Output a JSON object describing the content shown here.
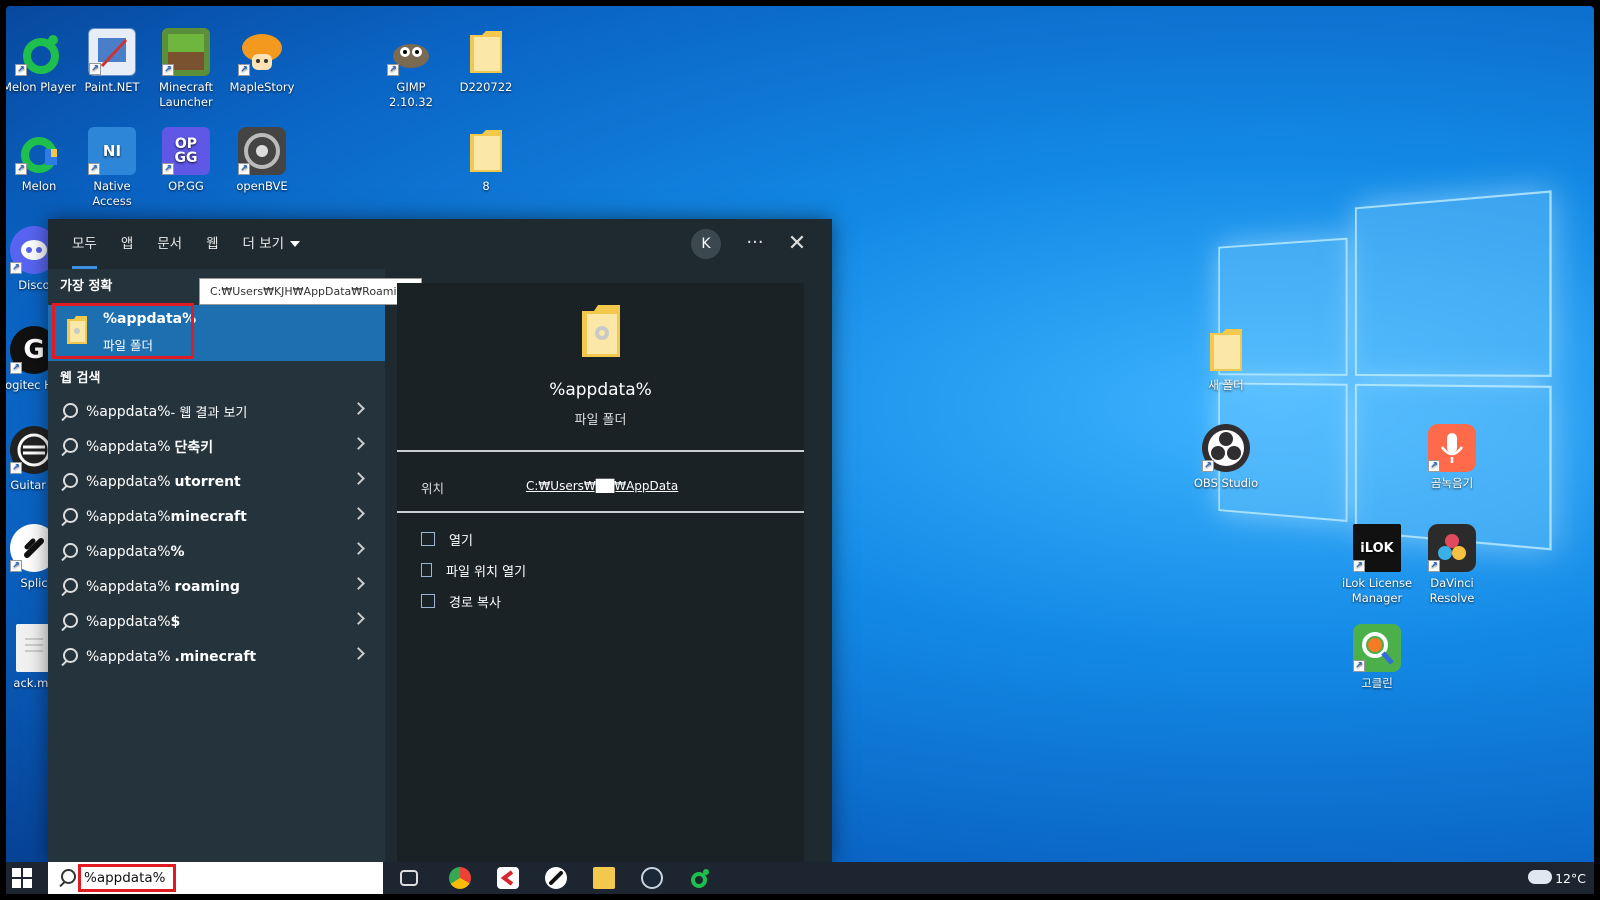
{
  "desktop_icons": [
    {
      "label": "Melon Player",
      "color": "#1fbf4e",
      "glyph": ""
    },
    {
      "label": "Paint.NET",
      "color": "#4a7ec8",
      "glyph": ""
    },
    {
      "label": "Minecraft Launcher",
      "color": "#5b8f3a",
      "glyph": ""
    },
    {
      "label": "MapleStory",
      "color": "#f3a52a",
      "glyph": ""
    },
    {
      "label": "GIMP 2.10.32",
      "color": "#7a6a52",
      "glyph": ""
    },
    {
      "label": "D220722",
      "color": "#f7d77a",
      "glyph": ""
    },
    {
      "label": "Melon",
      "color": "#1fbf4e",
      "glyph": ""
    },
    {
      "label": "Native Access",
      "color": "#2e86d9",
      "glyph": "NI"
    },
    {
      "label": "OP.GG",
      "color": "#5f57e6",
      "glyph": "OP GG"
    },
    {
      "label": "openBVE",
      "color": "#444",
      "glyph": ""
    },
    {
      "label": "8",
      "color": "#f7d77a",
      "glyph": ""
    },
    {
      "label": "Disco",
      "color": "#5865f2",
      "glyph": ""
    },
    {
      "label": "Logitec HUB",
      "color": "#111",
      "glyph": "G"
    },
    {
      "label": "Guitar R",
      "color": "#222",
      "glyph": ""
    },
    {
      "label": "Splic",
      "color": "#111",
      "glyph": ""
    },
    {
      "label": "ack.mc",
      "color": "#e8e8e8",
      "glyph": ""
    },
    {
      "label": "새 폴더",
      "color": "#f7d77a",
      "glyph": ""
    },
    {
      "label": "OBS Studio",
      "color": "#302e31",
      "glyph": ""
    },
    {
      "label": "곰녹음기",
      "color": "#ff6b4a",
      "glyph": ""
    },
    {
      "label": "iLok License Manager",
      "color": "#111",
      "glyph": "iLOK"
    },
    {
      "label": "DaVinci Resolve",
      "color": "#2b2b2b",
      "glyph": ""
    },
    {
      "label": "고클린",
      "color": "#4cb04a",
      "glyph": ""
    }
  ],
  "search_panel": {
    "tabs": [
      "모두",
      "앱",
      "문서",
      "웹",
      "더 보기"
    ],
    "avatar_letter": "K",
    "more_label": "···",
    "close_label": "✕",
    "best_match_heading": "가장 정확",
    "best_match": {
      "title": "%appdata%",
      "subtitle": "파일 폴더"
    },
    "tooltip": "C:₩Users₩KJH₩AppData₩Roaming",
    "web_search_heading": "웹 검색",
    "web_results": [
      {
        "prefix": "%appdata%",
        "suffix": " - 웹 결과 보기",
        "bold": ""
      },
      {
        "prefix": "%appdata%",
        "suffix": "",
        "bold": "단축키"
      },
      {
        "prefix": "%appdata%",
        "suffix": "",
        "bold": "utorrent"
      },
      {
        "prefix": "%appdata%",
        "suffix": "",
        "bold": "minecraft"
      },
      {
        "prefix": "%appdata%",
        "suffix": "",
        "bold": "%"
      },
      {
        "prefix": "%appdata%",
        "suffix": "",
        "bold": "roaming"
      },
      {
        "prefix": "%appdata%",
        "suffix": "",
        "bold": "$"
      },
      {
        "prefix": "%appdata%",
        "suffix": "",
        "bold": ".minecraft"
      }
    ],
    "preview": {
      "name": "%appdata%",
      "type": "파일 폴더",
      "location_label": "위치",
      "location_value": "C:₩Users₩██₩AppData",
      "actions": [
        "열기",
        "파일 위치 열기",
        "경로 복사"
      ]
    }
  },
  "taskbar": {
    "search_value": "%appdata%",
    "temperature": "12°C",
    "pinned": [
      "task-view",
      "chrome",
      "cakewalk",
      "splice",
      "file-explorer",
      "steam",
      "melon"
    ]
  },
  "colors": {
    "accent": "#1e6fb0",
    "highlight_box": "#e01b24",
    "panel_bg": "#1f2a30"
  }
}
